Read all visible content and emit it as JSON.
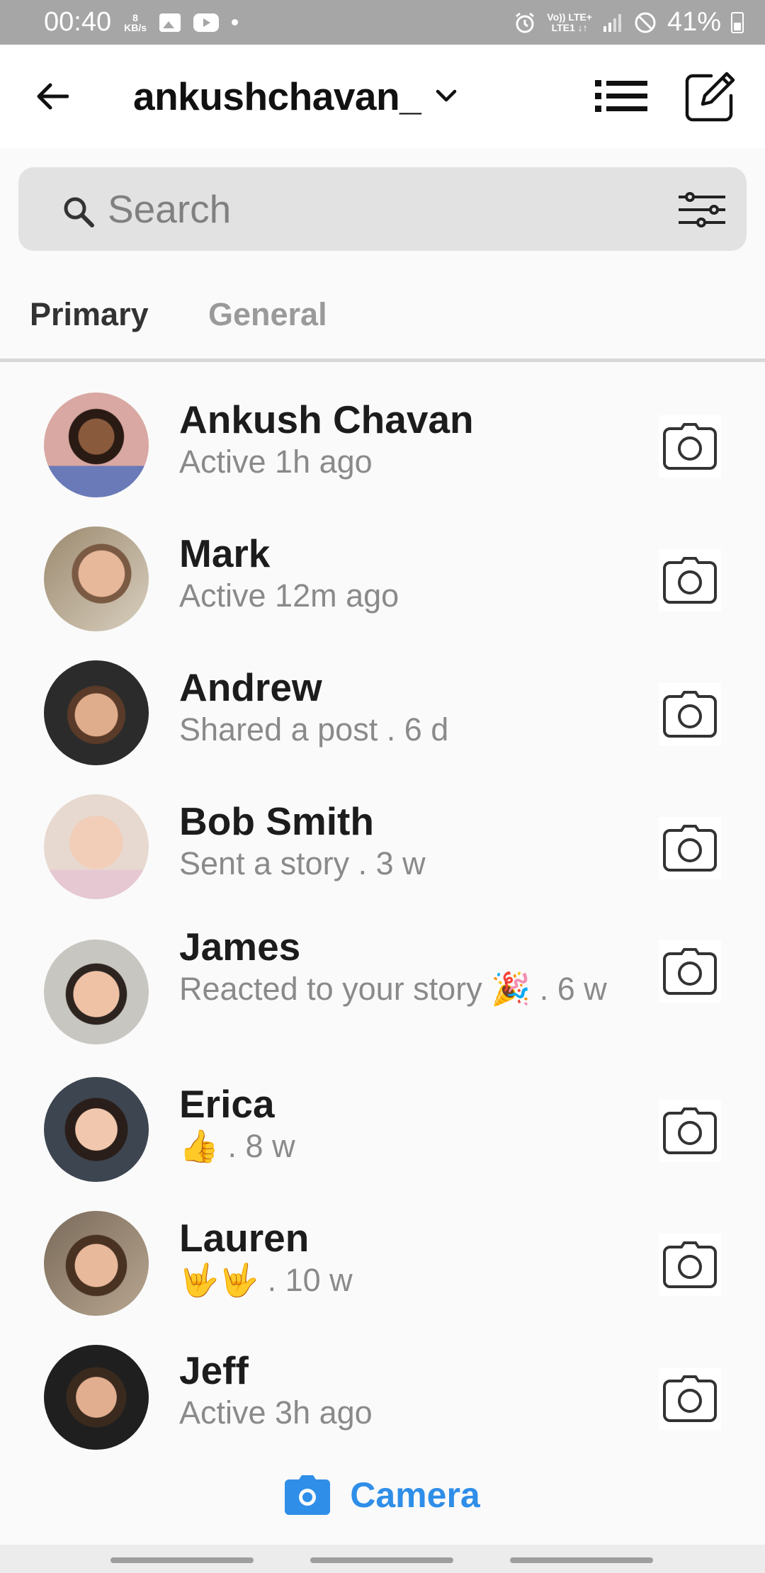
{
  "status_bar": {
    "time": "00:40",
    "data_speed_value": "8",
    "data_speed_unit": "KB/s",
    "network_top": "Vo)) LTE+",
    "network_bottom": "LTE1 ↓↑",
    "battery": "41%"
  },
  "header": {
    "account_name": "ankushchavan_",
    "back_icon": "back-arrow-icon",
    "chevron_icon": "chevron-down-icon",
    "list_icon": "list-icon",
    "compose_icon": "compose-icon"
  },
  "search": {
    "placeholder": "Search",
    "icon": "search-icon",
    "filter_icon": "filter-icon"
  },
  "tabs": [
    {
      "label": "Primary",
      "active": true
    },
    {
      "label": "General",
      "active": false
    }
  ],
  "threads": [
    {
      "name": "Ankush Chavan",
      "subtitle": "Active 1h ago"
    },
    {
      "name": "Mark",
      "subtitle": "Active 12m ago"
    },
    {
      "name": "Andrew",
      "subtitle": "Shared a post . 6 d"
    },
    {
      "name": "Bob Smith",
      "subtitle": "Sent a story . 3 w"
    },
    {
      "name": "James",
      "subtitle": "Reacted to your story 🎉 . 6 w"
    },
    {
      "name": "Erica",
      "subtitle": "👍 . 8 w"
    },
    {
      "name": "Lauren",
      "subtitle": "🤟🤟 . 10 w"
    },
    {
      "name": "Jeff",
      "subtitle": "Active 3h ago"
    }
  ],
  "bottom_camera": {
    "label": "Camera",
    "icon": "camera-icon",
    "color": "#2f8ee8"
  }
}
